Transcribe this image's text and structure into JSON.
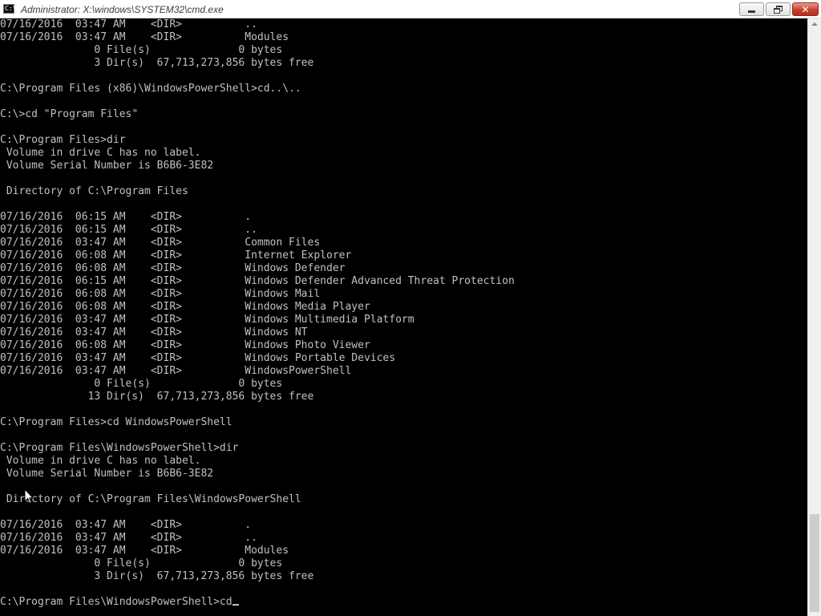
{
  "window": {
    "title": "Administrator: X:\\windows\\SYSTEM32\\cmd.exe",
    "app_icon_text": "C:\\",
    "close_glyph": "✕"
  },
  "console": {
    "lines": [
      "07/16/2016  03:47 AM    <DIR>          ..",
      "07/16/2016  03:47 AM    <DIR>          Modules",
      "               0 File(s)              0 bytes",
      "               3 Dir(s)  67,713,273,856 bytes free",
      "",
      "C:\\Program Files (x86)\\WindowsPowerShell>cd..\\..",
      "",
      "C:\\>cd \"Program Files\"",
      "",
      "C:\\Program Files>dir",
      " Volume in drive C has no label.",
      " Volume Serial Number is B6B6-3E82",
      "",
      " Directory of C:\\Program Files",
      "",
      "07/16/2016  06:15 AM    <DIR>          .",
      "07/16/2016  06:15 AM    <DIR>          ..",
      "07/16/2016  03:47 AM    <DIR>          Common Files",
      "07/16/2016  06:08 AM    <DIR>          Internet Explorer",
      "07/16/2016  06:08 AM    <DIR>          Windows Defender",
      "07/16/2016  06:15 AM    <DIR>          Windows Defender Advanced Threat Protection",
      "07/16/2016  06:08 AM    <DIR>          Windows Mail",
      "07/16/2016  06:08 AM    <DIR>          Windows Media Player",
      "07/16/2016  03:47 AM    <DIR>          Windows Multimedia Platform",
      "07/16/2016  03:47 AM    <DIR>          Windows NT",
      "07/16/2016  06:08 AM    <DIR>          Windows Photo Viewer",
      "07/16/2016  03:47 AM    <DIR>          Windows Portable Devices",
      "07/16/2016  03:47 AM    <DIR>          WindowsPowerShell",
      "               0 File(s)              0 bytes",
      "              13 Dir(s)  67,713,273,856 bytes free",
      "",
      "C:\\Program Files>cd WindowsPowerShell",
      "",
      "C:\\Program Files\\WindowsPowerShell>dir",
      " Volume in drive C has no label.",
      " Volume Serial Number is B6B6-3E82",
      "",
      " Directory of C:\\Program Files\\WindowsPowerShell",
      "",
      "07/16/2016  03:47 AM    <DIR>          .",
      "07/16/2016  03:47 AM    <DIR>          ..",
      "07/16/2016  03:47 AM    <DIR>          Modules",
      "               0 File(s)              0 bytes",
      "               3 Dir(s)  67,713,273,856 bytes free",
      "",
      "C:\\Program Files\\WindowsPowerShell>cd"
    ]
  },
  "colors": {
    "console_background": "#000000",
    "console_text": "#c0c0c0",
    "titlebar_background": "#ffffff",
    "close_button": "#c8412d"
  },
  "icons": {
    "app": "cmd-icon",
    "minimize": "minimize-icon",
    "restore": "restore-icon",
    "close": "close-icon",
    "pointer": "mouse-pointer-icon"
  }
}
